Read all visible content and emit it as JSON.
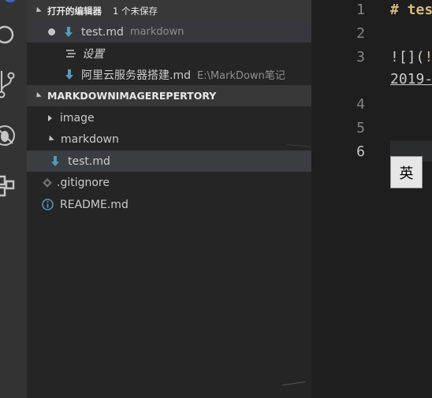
{
  "open_editors": {
    "header": "打开的编辑器",
    "unsaved_badge": "1 个未保存",
    "items": [
      {
        "name": "test.md",
        "desc": "markdown"
      },
      {
        "name": "设置",
        "desc": ""
      },
      {
        "name": "阿里云服务器搭建.md",
        "desc": "E:\\MarkDown笔记"
      }
    ]
  },
  "explorer": {
    "header": "MARKDOWNIMAGEREPERTORY",
    "items": [
      {
        "name": "image",
        "type": "folder",
        "expanded": false
      },
      {
        "name": "markdown",
        "type": "folder",
        "expanded": true
      },
      {
        "name": "test.md",
        "type": "markdown-file",
        "selected": true
      },
      {
        "name": ".gitignore",
        "type": "git-file"
      },
      {
        "name": "README.md",
        "type": "info-file"
      }
    ]
  },
  "editor": {
    "line_numbers": [
      "1",
      "2",
      "3",
      "4",
      "5",
      "6"
    ],
    "line1_text": "# tes",
    "line3_text": "![](",
    "line3_extra": "!",
    "line3_wrap": "2019-",
    "ime_indicator": "英"
  },
  "colors": {
    "accent": "#3b8eea",
    "markdown_icon": "#519aba",
    "heading": "#d7ba7d"
  }
}
